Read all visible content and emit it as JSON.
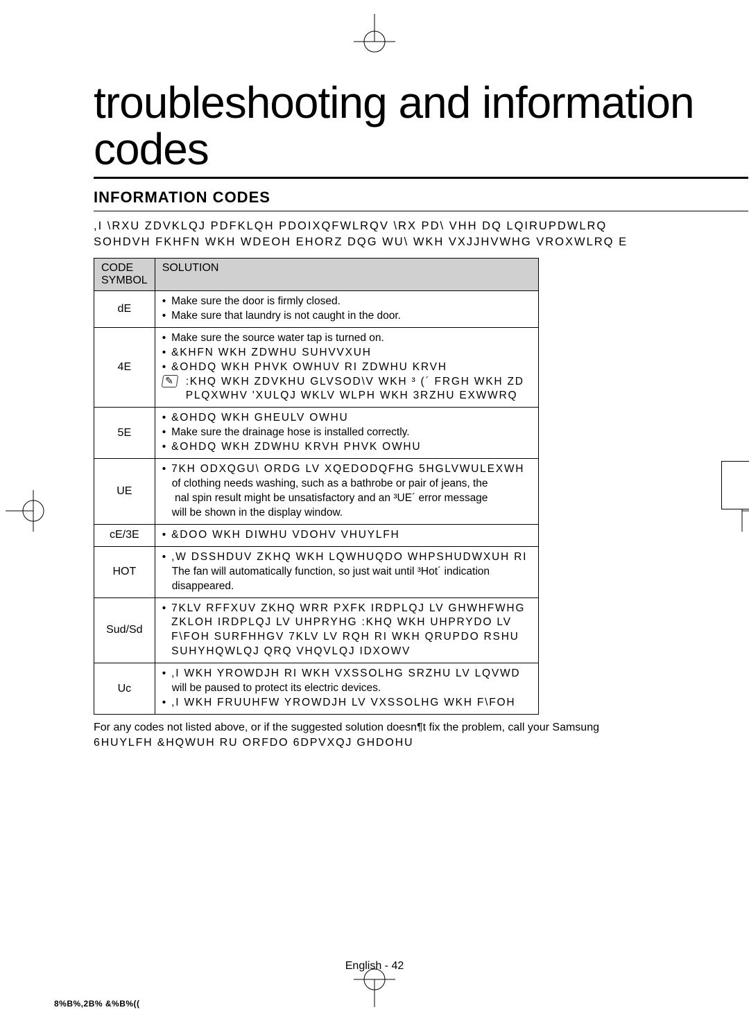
{
  "page": {
    "title": "troubleshooting and information codes",
    "section_header": "INFORMATION CODES",
    "intro_line1": ",I \\RXU ZDVKLQJ PDFKLQH PDOIXQFWLRQV  \\RX PD\\ VHH DQ LQIRUPDWLRQ",
    "intro_line2": "SOHDVH FKHFN WKH WDEOH EHORZ DQG WU\\ WKH VXJJHVWHG VROXWLRQ E",
    "table": {
      "header_code": "CODE SYMBOL",
      "header_solution": "SOLUTION",
      "rows": [
        {
          "code": "dE",
          "solutions": [
            "Make sure the door is ﬁrmly closed.",
            "Make sure that laundry is not caught in the door."
          ]
        },
        {
          "code": "4E",
          "solutions": [
            "Make sure the source water tap is turned on.",
            "&KHFN WKH ZDWHU SUHVVXUH",
            "&OHDQ WKH PHVK  OWHUV RI ZDWHU KRVH"
          ],
          "note_line1": ":KHQ WKH ZDVKHU GLVSOD\\V WKH ³ (´ FRGH  WKH ZD",
          "note_line2": "PLQXWHV  'XULQJ WKLV WLPH  WKH 3RZHU EXWWRQ"
        },
        {
          "code": "5E",
          "solutions": [
            "&OHDQ WKH GHEULV  OWHU",
            "Make sure the drainage hose is installed correctly.",
            "&OHDQ WKH ZDWHU KRVH PHVK  OWHU"
          ]
        },
        {
          "code": "UE",
          "solutions_mixed": [
            {
              "sp": true,
              "text": "7KH ODXQGU\\ ORDG LV XQEDODQFHG  5HGLVWULEXWH"
            },
            {
              "sp": false,
              "text": "of clothing needs washing, such as a bathrobe or pair of jeans, the"
            },
            {
              "sp": false,
              "text": " nal spin result might be unsatisfactory and an ³UE´ error message"
            },
            {
              "sp": false,
              "text": "will be shown in the display window."
            }
          ]
        },
        {
          "code": "cE/3E",
          "solutions": [
            "&DOO WKH DIWHU VDOHV VHUYLFH"
          ]
        },
        {
          "code": "HOT",
          "solutions_mixed": [
            {
              "sp": true,
              "bullet": true,
              "text": ",W DSSHDUV ZKHQ WKH LQWHUQDO WHPSHUDWXUH RI"
            },
            {
              "sp": false,
              "text": "The fan will automatically function, so just wait until ³Hot´ indication"
            },
            {
              "sp": false,
              "text": "disappeared."
            }
          ]
        },
        {
          "code": "Sud/Sd",
          "solutions": [
            "7KLV RFFXUV ZKHQ WRR PXFK IRDPLQJ LV GHWHFWHG",
            "ZKLOH IRDPLQJ LV UHPRYHG  :KHQ WKH UHPRYDO LV",
            "F\\FOH SURFHHGV  7KLV LV RQH RI WKH QRUPDO RSHU",
            "SUHYHQWLQJ QRQ VHQVLQJ IDXOWV"
          ],
          "first_bullet_only": true
        },
        {
          "code": "Uc",
          "solutions_mixed": [
            {
              "sp": true,
              "bullet": true,
              "text": ",I WKH YROWDJH RI WKH VXSSOLHG SRZHU LV LQVWD"
            },
            {
              "sp": false,
              "text": "will be paused to protect its electric devices."
            },
            {
              "sp": true,
              "bullet": true,
              "text": ",I WKH FRUUHFW YROWDJH LV VXSSOLHG  WKH F\\FOH"
            }
          ]
        }
      ]
    },
    "footnote_line1": "For any codes not listed above, or if the suggested solution doesn¶t ﬁx the problem, call your Samsung",
    "footnote_line2": "6HUYLFH &HQWUH RU ORFDO 6DPVXQJ GHDOHU",
    "page_footer": "English - 42",
    "small_footer": "8%B%,2B% &%B%(("
  }
}
